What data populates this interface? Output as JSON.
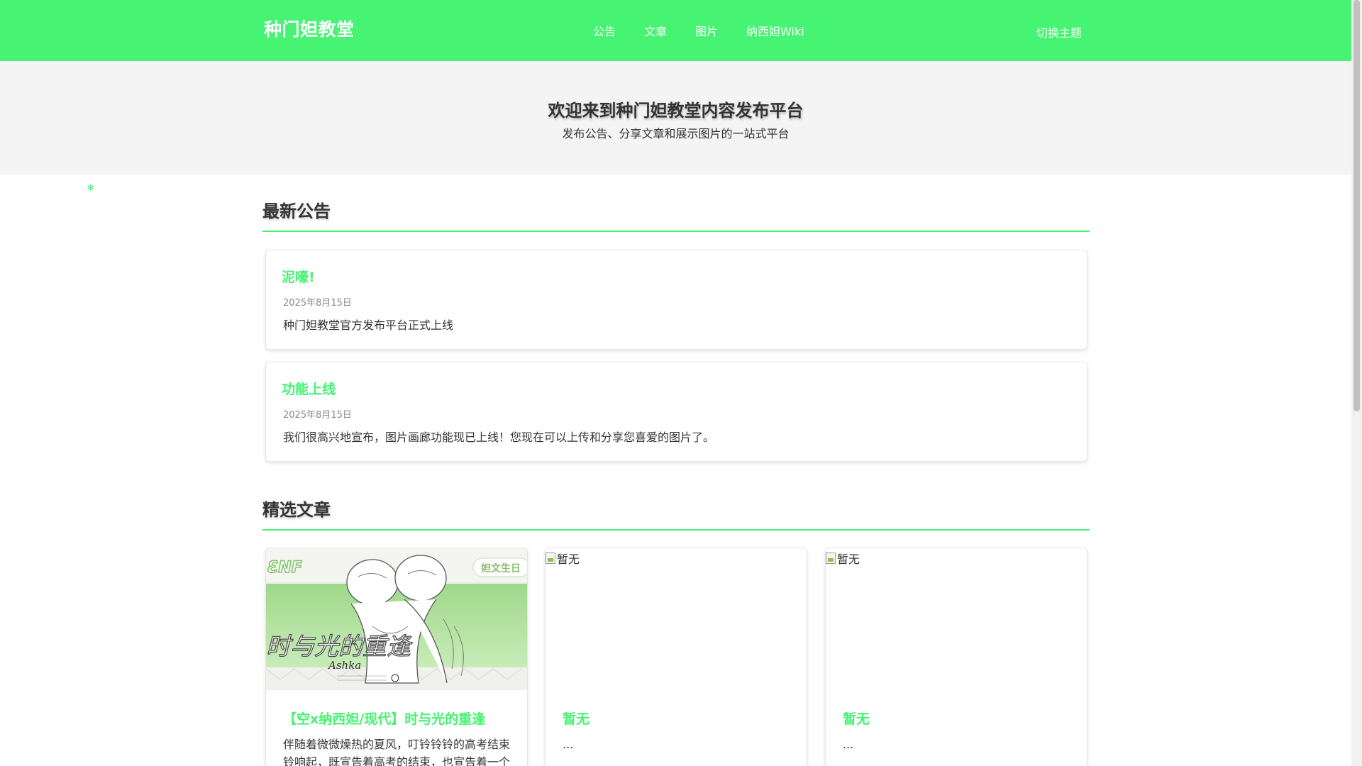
{
  "header": {
    "logo": "种门妲教堂",
    "nav": [
      {
        "label": "公告"
      },
      {
        "label": "文章"
      },
      {
        "label": "图片"
      },
      {
        "label": "纳西妲Wiki"
      }
    ],
    "theme_toggle": "切换主题",
    "bg_color": "#46f373"
  },
  "hero": {
    "title": "欢迎来到种门妲教堂内容发布平台",
    "subtitle": "发布公告、分享文章和展示图片的一站式平台"
  },
  "announcements": {
    "section_title": "最新公告",
    "items": [
      {
        "title": "泥嚎!",
        "date": "2025年8月15日",
        "body": "种门妲教堂官方发布平台正式上线"
      },
      {
        "title": "功能上线",
        "date": "2025年8月15日",
        "body": "我们很高兴地宣布，图片画廊功能现已上线！您现在可以上传和分享您喜爱的图片了。"
      }
    ]
  },
  "articles": {
    "section_title": "精选文章",
    "items": [
      {
        "title": "【空x纳西妲/现代】时与光的重逢",
        "excerpt": "伴随着微微燥热的夏风，叮铃铃铃的高考结束铃响起，既宣告着高考的结束，也宣告着一个",
        "image_alt": "",
        "has_image": true,
        "image_caption": "时与光的重逢",
        "image_signature": "Ashka",
        "image_badge": "妲文生日"
      },
      {
        "title": "暂无",
        "excerpt": "...",
        "image_alt": "暂无",
        "has_image": false
      },
      {
        "title": "暂无",
        "excerpt": "...",
        "image_alt": "暂无",
        "has_image": false
      }
    ]
  },
  "accent_color": "#46f373"
}
